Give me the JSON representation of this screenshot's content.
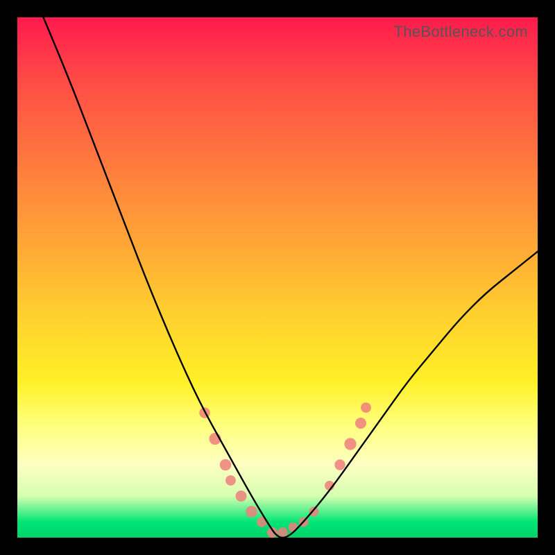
{
  "watermark": "TheBottleneck.com",
  "chart_data": {
    "type": "line",
    "title": "",
    "xlabel": "",
    "ylabel": "",
    "xlim": [
      0,
      100
    ],
    "ylim": [
      0,
      100
    ],
    "grid": false,
    "series": [
      {
        "name": "bottleneck-curve",
        "note": "approximate V-shaped bottleneck curve; y ≈ bottleneck %, x ≈ relative component score",
        "x": [
          5,
          10,
          15,
          20,
          25,
          30,
          35,
          40,
          45,
          48,
          50,
          52,
          55,
          60,
          65,
          70,
          75,
          80,
          85,
          90,
          95,
          100
        ],
        "y": [
          100,
          88,
          75,
          62,
          49,
          37,
          26,
          17,
          8,
          3,
          0,
          0,
          3,
          9,
          16,
          23,
          30,
          36,
          42,
          47,
          51,
          55
        ]
      }
    ],
    "dot_clusters": {
      "note": "soft salmon dots near the curve trough and its flanks, approximate positions",
      "color": "#ef7f7c",
      "points": [
        {
          "x": 36,
          "y": 24,
          "r": 4.8
        },
        {
          "x": 38,
          "y": 19,
          "r": 5.4
        },
        {
          "x": 40,
          "y": 14,
          "r": 5.2
        },
        {
          "x": 41,
          "y": 11,
          "r": 4.6
        },
        {
          "x": 43,
          "y": 8,
          "r": 5.0
        },
        {
          "x": 45,
          "y": 5,
          "r": 5.2
        },
        {
          "x": 47,
          "y": 3,
          "r": 4.6
        },
        {
          "x": 49,
          "y": 1,
          "r": 4.8
        },
        {
          "x": 51,
          "y": 1,
          "r": 4.6
        },
        {
          "x": 53,
          "y": 2,
          "r": 4.4
        },
        {
          "x": 55,
          "y": 3,
          "r": 4.4
        },
        {
          "x": 57,
          "y": 5,
          "r": 4.4
        },
        {
          "x": 60,
          "y": 10,
          "r": 4.4
        },
        {
          "x": 62,
          "y": 14,
          "r": 4.8
        },
        {
          "x": 64,
          "y": 18,
          "r": 5.4
        },
        {
          "x": 66,
          "y": 22,
          "r": 5.0
        },
        {
          "x": 67,
          "y": 25,
          "r": 4.6
        }
      ]
    }
  }
}
